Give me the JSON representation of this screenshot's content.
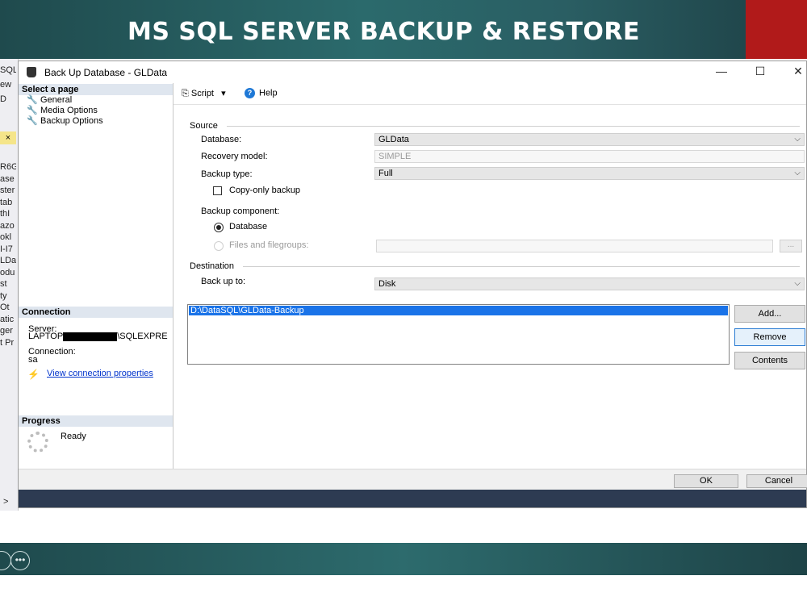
{
  "slide": {
    "title": "MS SQL SERVER BACKUP & RESTORE"
  },
  "ssms_background": {
    "fragments": [
      "SQL",
      "ew",
      "D",
      "×",
      "R6G",
      "ase",
      "ster",
      "tab",
      "thI",
      "azo",
      "okl",
      "I-I7",
      "LDa",
      "odu",
      "st",
      "ty",
      "Ot",
      "atic",
      "ger",
      "t Pr",
      ">"
    ]
  },
  "dialog": {
    "title": "Back Up Database - GLData",
    "window_controls": {
      "minimize": "—",
      "maximize": "☐",
      "close": "✕"
    },
    "left_pane": {
      "select_page_header": "Select a page",
      "pages": [
        "General",
        "Media Options",
        "Backup Options"
      ],
      "connection_header": "Connection",
      "server_label": "Server:",
      "server_prefix": "LAPTOP",
      "server_suffix": "\\SQLEXPRE",
      "connection_label": "Connection:",
      "connection_value": "sa",
      "view_connection_link": "View connection properties",
      "progress_header": "Progress",
      "progress_status": "Ready"
    },
    "toolbar": {
      "script_label": "Script",
      "help_label": "Help"
    },
    "source": {
      "group_label": "Source",
      "database_label": "Database:",
      "database_value": "GLData",
      "recovery_label": "Recovery model:",
      "recovery_value": "SIMPLE",
      "backup_type_label": "Backup type:",
      "backup_type_value": "Full",
      "copy_only_label": "Copy-only backup",
      "copy_only_checked": false,
      "component_label": "Backup component:",
      "component_database": "Database",
      "component_files": "Files and filegroups:",
      "browse_label": "..."
    },
    "destination": {
      "group_label": "Destination",
      "backup_to_label": "Back up to:",
      "backup_to_value": "Disk",
      "paths": [
        "D:\\DataSQL\\GLData-Backup"
      ],
      "add_button": "Add...",
      "remove_button": "Remove",
      "contents_button": "Contents"
    },
    "footer": {
      "ok_button": "OK",
      "cancel_button": "Cancel"
    }
  },
  "footer_icons": {
    "more_icon": "•••"
  }
}
